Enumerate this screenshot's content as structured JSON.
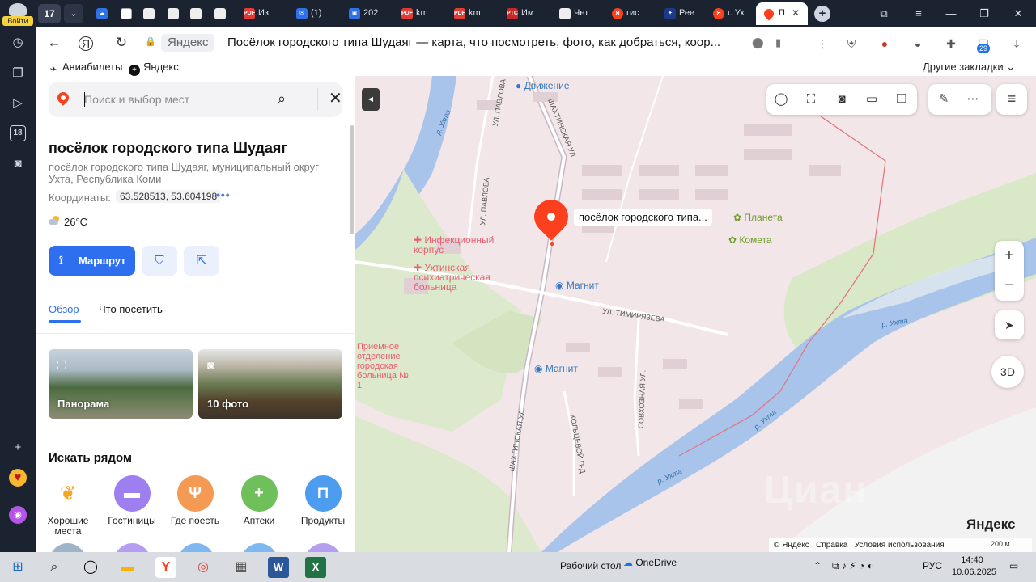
{
  "sidepanel": {
    "login_label": "Войти",
    "tab_badge": "18"
  },
  "tabbar": {
    "tab_count": "17",
    "tabs": [
      {
        "title": "Из"
      },
      {
        "title": "(1)"
      },
      {
        "title": "202"
      },
      {
        "title": "km"
      },
      {
        "title": "km"
      },
      {
        "title": "Им"
      },
      {
        "title": "Чет"
      },
      {
        "title": "гис"
      },
      {
        "title": "Рее"
      },
      {
        "title": "г. Ух"
      }
    ],
    "active_tab_title": "П"
  },
  "addressbar": {
    "site": "Яндекс",
    "title": "Посёлок городского типа Шудаяг — карта, что посмотреть, фото, как добраться, коор..."
  },
  "bookmarks": {
    "items": [
      "Авиабилеты",
      "Яндекс"
    ],
    "other": "Другие закладки"
  },
  "downloads_badge": "29",
  "panel": {
    "search_placeholder": "Поиск и выбор мест",
    "place_title": "посёлок городского типа Шудаяг",
    "place_desc": "посёлок городского типа Шудаяг, муниципальный округ Ухта, Республика Коми",
    "coords_label": "Координаты:",
    "coords_value": "63.528513, 53.604198",
    "weather": "26°C",
    "route_label": "Маршрут",
    "tabs": [
      "Обзор",
      "Что посетить"
    ],
    "photos": [
      {
        "label": "Панорама"
      },
      {
        "label": "10 фото"
      }
    ],
    "nearby_title": "Искать рядом",
    "categories": [
      {
        "label": "Хорошие места",
        "color": "#fff"
      },
      {
        "label": "Гостиницы",
        "color": "#9e7ff0"
      },
      {
        "label": "Где поесть",
        "color": "#f59a52"
      },
      {
        "label": "Аптеки",
        "color": "#6fc05a"
      },
      {
        "label": "Продукты",
        "color": "#4c9df0"
      }
    ]
  },
  "map": {
    "pin_label": "посёлок городского типа...",
    "pois": {
      "dvizhenie": "Движение",
      "planeta": "Планета",
      "kometa": "Комета",
      "infek": "Инфекционный корпус",
      "psych": "Ухтинская психиатрическая больница",
      "magnit1": "Магнит",
      "magnit2": "Магнит",
      "priemnoe": "Приемное отделение городская больница № 1"
    },
    "streets": {
      "shakht1": "ШАХТИНСКАЯ УЛ.",
      "shakht2": "ШАХТИНСКАЯ УЛ.",
      "pavlova1": "УЛ. ПАВЛОВА",
      "pavlova2": "УЛ. ПАВЛОВА",
      "timir": "УЛ. ТИМИРЯЗЕВА",
      "sovkhoz": "СОВХОЗНАЯ УЛ.",
      "koltsev": "КОЛЬЦЕВОЙ П-Д"
    },
    "river": "р. Ухта",
    "logo": "Яндекс",
    "copyright_items": [
      "© Яндекс",
      "Справка",
      "Условия использования"
    ],
    "scale": "200 м",
    "btn_3d": "3D",
    "watermark": "Циан"
  },
  "taskbar": {
    "desktop": "Рабочий стол",
    "onedrive": "OneDrive",
    "lang": "РУС",
    "time": "14:40",
    "date": "10.06.2025"
  }
}
